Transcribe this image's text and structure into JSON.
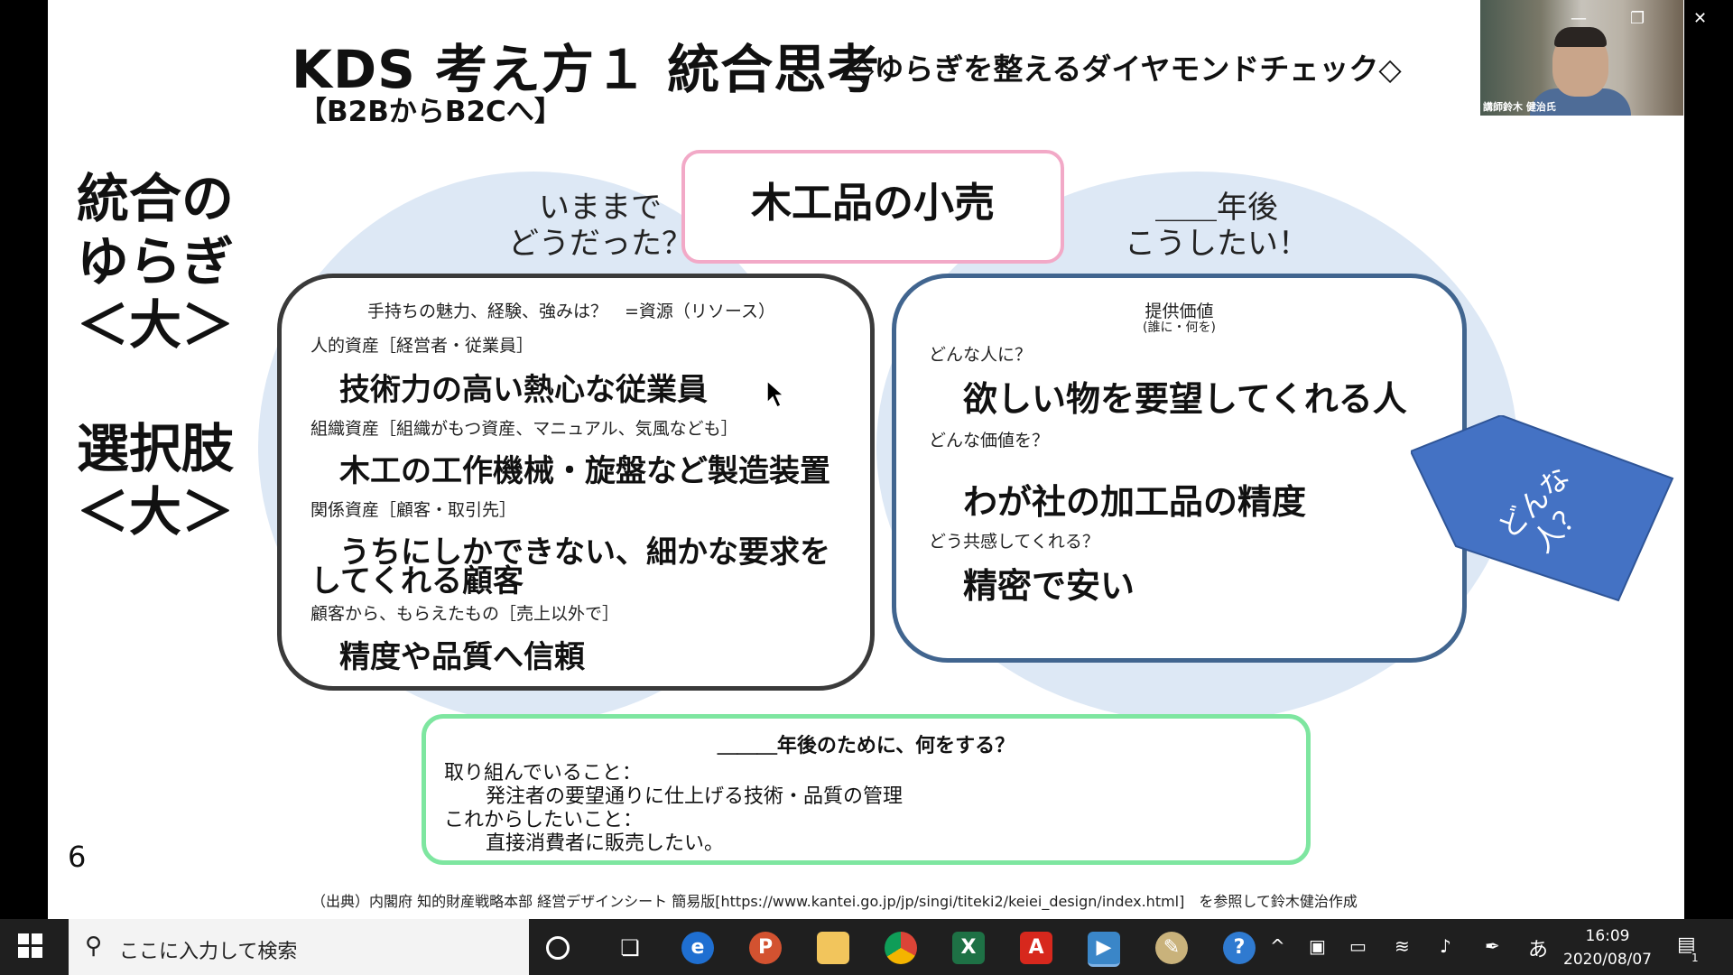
{
  "slide": {
    "title": "KDS 考え方１ 統合思考",
    "title_sub": "◇ゆらぎを整えるダイヤモンドチェック◇",
    "title_sub2": "【B2BからB2Cへ】",
    "left_label_1": [
      "統合の",
      "ゆらぎ",
      "＜大＞"
    ],
    "left_label_2": [
      "選択肢",
      "＜大＞"
    ],
    "product_box": "木工品の小売",
    "left_header": [
      "いままで",
      "どうだった？"
    ],
    "right_header": [
      "＿＿年後",
      "こうしたい！"
    ],
    "left_box": {
      "intro": "手持ちの魅力、経験、強みは？　=資源（リソース）",
      "label_1": "人的資産［経営者・従業員］",
      "value_1": "技術力の高い熱心な従業員",
      "label_2": "組織資産［組織がもつ資産、マニュアル、気風なども］",
      "value_2": "木工の工作機械・旋盤など製造装置",
      "label_3": "関係資産［顧客・取引先］",
      "value_3a": "うちにしかできない、細かな要求を",
      "value_3b": "してくれる顧客",
      "label_4": "顧客から、もらえたもの［売上以外で］",
      "value_4": "精度や品質へ信頼"
    },
    "right_box": {
      "heading": "提供価値",
      "heading_note": "(誰に・何を)",
      "label_1": "どんな人に？",
      "value_1": "欲しい物を要望してくれる人",
      "label_2": "どんな価値を？",
      "value_2": "わが社の加工品の精度",
      "label_3": "どう共感してくれる？",
      "value_3": "精密で安い"
    },
    "pentagon_text": [
      "どんな",
      "人？"
    ],
    "bottom_box": {
      "heading": "＿＿＿年後のために、何をする？",
      "line_1": "取り組んでいること：",
      "line_2": "発注者の要望通りに仕上げる技術・品質の管理",
      "line_3": "これからしたいこと：",
      "line_4": "直接消費者に販売したい。"
    },
    "page_number": "6",
    "source": "（出典）内閣府 知的財産戦略本部 経営デザインシート 簡易版[https://www.kantei.go.jp/jp/singi/titeki2/keiei_design/index.html]　を参照して鈴木健治作成"
  },
  "video": {
    "caption": "講師鈴木 健治氏"
  },
  "window_controls": {
    "minimize": "—",
    "restore": "❐",
    "close": "✕"
  },
  "taskbar": {
    "search_placeholder": "ここに入力して検索",
    "apps": [
      "cortana-icon",
      "task-view-icon",
      "edge-icon",
      "powerpoint-icon",
      "file-explorer-icon",
      "chrome-icon",
      "excel-icon",
      "acrobat-icon",
      "media-player-icon",
      "paint-icon",
      "help-icon"
    ],
    "ime": "あ",
    "time": "16:09",
    "date": "2020/08/07",
    "notification_count": "1"
  }
}
